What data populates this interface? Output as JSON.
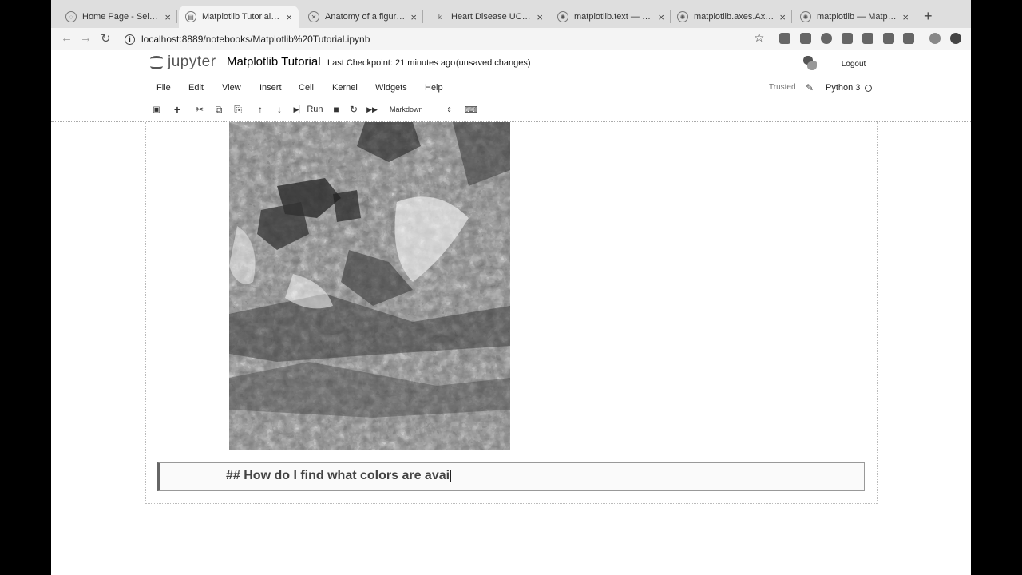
{
  "browser": {
    "tabs": [
      {
        "label": "Home Page - Select o"
      },
      {
        "label": "Matplotlib Tutorial - J"
      },
      {
        "label": "Anatomy of a figure —"
      },
      {
        "label": "Heart Disease UCI | K"
      },
      {
        "label": "matplotlib.text — Mat"
      },
      {
        "label": "matplotlib.axes.Axes."
      },
      {
        "label": "matplotlib — Matplotl"
      }
    ],
    "url": "localhost:8889/notebooks/Matplotlib%20Tutorial.ipynb",
    "new_tab_label": "+"
  },
  "jupyter": {
    "logo_text": "jupyter",
    "notebook_title": "Matplotlib Tutorial",
    "checkpoint": "Last Checkpoint: 21 minutes ago",
    "unsaved": "(unsaved changes)",
    "logout": "Logout",
    "menu": [
      "File",
      "Edit",
      "View",
      "Insert",
      "Cell",
      "Kernel",
      "Widgets",
      "Help"
    ],
    "trusted": "Trusted",
    "kernel": "Python 3",
    "run_label": "Run",
    "cell_type": "Markdown"
  },
  "cell": {
    "markdown_text": "## How do I find what colors are avai"
  },
  "colors": {
    "outer_background": "#000000",
    "tabstrip": "#dedede",
    "page": "#ffffff"
  }
}
